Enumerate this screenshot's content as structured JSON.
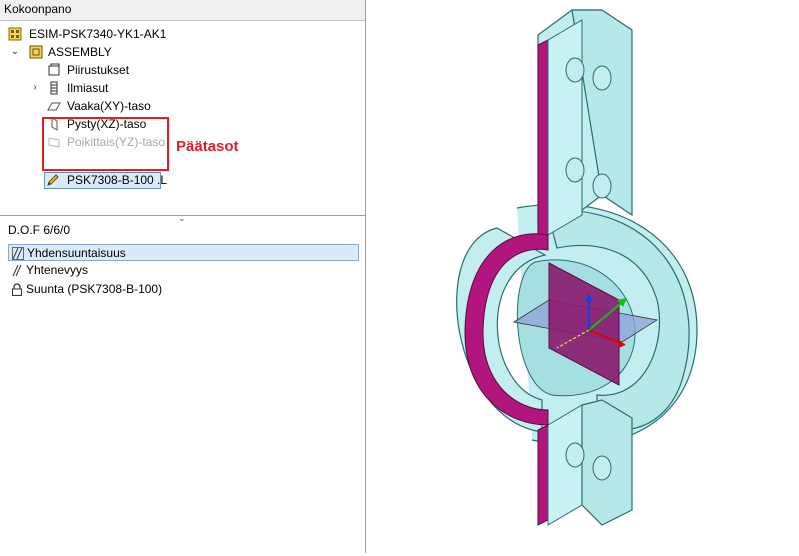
{
  "panel": {
    "title": "Kokoonpano"
  },
  "tree": {
    "root": "ESIM-PSK7340-YK1-AK1",
    "assembly": "ASSEMBLY",
    "drawings": "Piirustukset",
    "views": "Ilmiasut",
    "planes": [
      {
        "label": "Vaaka(XY)-taso",
        "disabled": false
      },
      {
        "label": "Pysty(XZ)-taso",
        "disabled": false
      },
      {
        "label": "Poikittais(YZ)-taso",
        "disabled": true
      }
    ],
    "part": "PSK7308-B-100 .L"
  },
  "annotation": {
    "text": "Päätasot",
    "color": "#e41e26"
  },
  "dof": {
    "label": "D.O.F",
    "value": "6/6/0"
  },
  "constraints": [
    {
      "label": "Yhdensuuntaisuus",
      "icon": "parallel-icon",
      "selected": true
    },
    {
      "label": "Yhtenevyys",
      "icon": "coincident-icon",
      "selected": false
    },
    {
      "label": "Suunta (PSK7308-B-100)",
      "icon": "lock-icon",
      "selected": false
    }
  ],
  "colors": {
    "part_fill": "#c2eef0",
    "part_edge": "#2a6d70",
    "section_face": "#b0167e",
    "plane_xy": "#8ea0d8",
    "axis_x": "#e00000",
    "axis_y": "#10c010",
    "axis_z": "#1040e0"
  }
}
